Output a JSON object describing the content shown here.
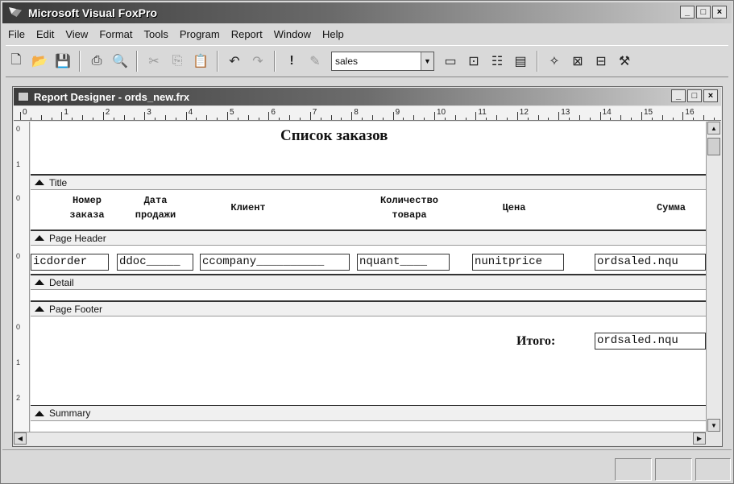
{
  "app": {
    "title": "Microsoft Visual FoxPro"
  },
  "menu": [
    "File",
    "Edit",
    "View",
    "Format",
    "Tools",
    "Program",
    "Report",
    "Window",
    "Help"
  ],
  "toolbar": {
    "combo_value": "sales",
    "icons": [
      "new-file-icon",
      "open-folder-icon",
      "save-icon",
      "print-icon",
      "print-preview-icon",
      "cut-icon",
      "copy-icon",
      "paste-icon",
      "undo-icon",
      "redo-icon",
      "run-icon",
      "modify-icon",
      "command-window-icon",
      "data-session-icon",
      "properties-icon",
      "report-designer-icon",
      "builder-icon",
      "form-wizard-icon",
      "toolbox-icon",
      "tools-icon"
    ]
  },
  "window": {
    "title": "Report Designer - ords_new.frx",
    "ruler": [
      "0",
      "1",
      "2",
      "3",
      "4",
      "5",
      "6",
      "7",
      "8",
      "9",
      "10",
      "11",
      "12",
      "13",
      "14",
      "15",
      "16"
    ]
  },
  "report": {
    "title": "Список заказов",
    "bands": {
      "title": "Title",
      "page_header": "Page Header",
      "detail": "Detail",
      "page_footer": "Page Footer",
      "summary": "Summary"
    },
    "headers": [
      "Номер\nзаказа",
      "Дата\nпродажи",
      "Клиент",
      "Количество\nтовара",
      "Цена",
      "Сумма"
    ],
    "detail_fields": [
      "icdorder",
      "ddoc_____",
      "ccompany__________",
      "nquant____",
      "nunitprice",
      "ordsaled.nqu"
    ],
    "summary": {
      "label": "Итого:",
      "field": "ordsaled.nqu"
    }
  },
  "vruler": [
    "0",
    "1",
    "0",
    "0",
    "0",
    "1",
    "2"
  ]
}
